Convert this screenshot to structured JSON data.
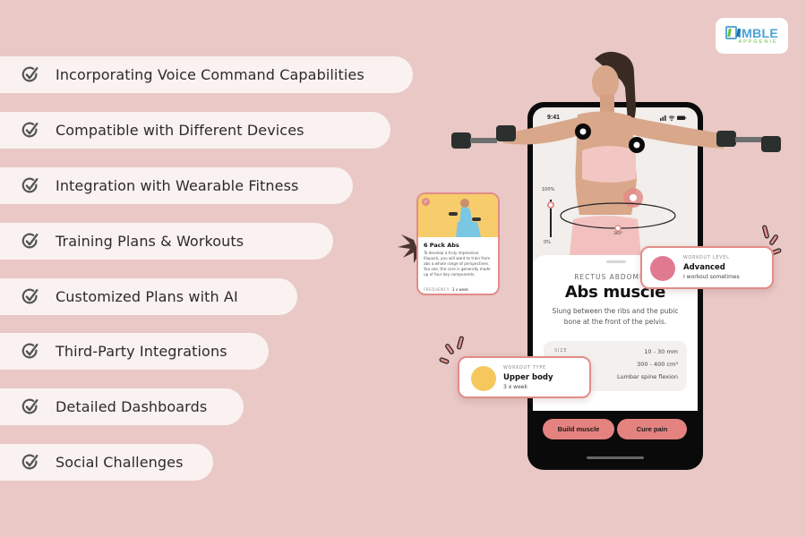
{
  "features": [
    {
      "label": "Incorporating Voice Command Capabilities",
      "icon": "check-circle-icon"
    },
    {
      "label": "Compatible with Different Devices",
      "icon": "check-circle-icon"
    },
    {
      "label": "Integration with Wearable Fitness",
      "icon": "check-circle-icon"
    },
    {
      "label": "Training Plans & Workouts",
      "icon": "check-circle-icon"
    },
    {
      "label": "Customized Plans with AI",
      "icon": "check-circle-icon"
    },
    {
      "label": "Third-Party Integrations",
      "icon": "check-circle-icon"
    },
    {
      "label": "Detailed Dashboards",
      "icon": "check-circle-icon"
    },
    {
      "label": "Social Challenges",
      "icon": "check-circle-icon"
    }
  ],
  "logo": {
    "name": "IMBLE",
    "tagline": "APPGENIE"
  },
  "phone": {
    "status_time": "9:41",
    "status_icons": "signal-wifi-battery",
    "slider": {
      "top_label": "100%",
      "bottom_label": "0%",
      "value_percent": 85
    },
    "rotation_label": "360°",
    "sheet": {
      "eyebrow": "RECTUS ABDOMINIS",
      "title": "Abs muscle",
      "description": "Slung between the ribs and the pubic bone at the front of the pelvis.",
      "stats": {
        "key": "SIZE",
        "values": [
          "10 - 30 mm",
          "300 - 400 cm³",
          "Lumbar spine flexion"
        ]
      }
    },
    "buttons": [
      "Build muscle",
      "Cure pain"
    ]
  },
  "cards": {
    "workout_level": {
      "eyebrow": "WORKOUT LEVEL",
      "title": "Advanced",
      "subtitle": "I workout sometimes"
    },
    "workout_type": {
      "eyebrow": "WORKOUT TYPE",
      "title": "Upper body",
      "subtitle": "3 x week"
    },
    "program": {
      "title": "6 Pack Abs",
      "body": "To develop a truly impressive 6ixpack, you will want to train from abs a whole range of perspectives. You see, the core is generally made up of four key components.",
      "frequency_label": "FREQUENCY",
      "frequency_value": "3 x week"
    }
  },
  "colors": {
    "background": "#e9c8c6",
    "pill": "#f9f2f1",
    "accent": "#e28c88",
    "button": "#e4827f"
  }
}
